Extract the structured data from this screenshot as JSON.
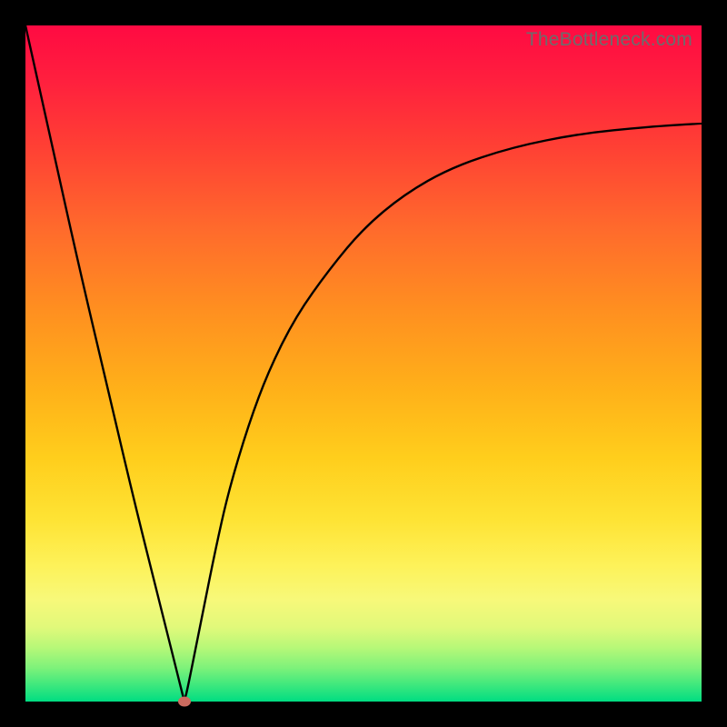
{
  "attribution": "TheBottleneck.com",
  "colors": {
    "marker": "#cb6b5f",
    "curve": "#000000"
  },
  "chart_data": {
    "type": "line",
    "title": "",
    "xlabel": "",
    "ylabel": "",
    "x_range": [
      0,
      100
    ],
    "y_range": [
      0,
      100
    ],
    "series": [
      {
        "name": "bottleneck-curve",
        "x": [
          0,
          4,
          8,
          12,
          16,
          20,
          23,
          23.5,
          24,
          26,
          28,
          30,
          33,
          36,
          40,
          45,
          50,
          56,
          63,
          72,
          82,
          92,
          100
        ],
        "y": [
          100,
          82,
          64,
          47,
          30,
          14,
          2,
          0,
          2,
          12,
          22,
          31,
          41,
          49,
          57,
          64,
          70,
          75,
          79,
          82,
          84,
          85,
          85.5
        ]
      }
    ],
    "marker": {
      "x": 23.5,
      "y": 0,
      "label": "optimal-point"
    },
    "gradient_stops": [
      {
        "pct": 0,
        "color": "#ff0a42"
      },
      {
        "pct": 50,
        "color": "#ffb119"
      },
      {
        "pct": 80,
        "color": "#fdf25a"
      },
      {
        "pct": 100,
        "color": "#00dd82"
      }
    ]
  }
}
